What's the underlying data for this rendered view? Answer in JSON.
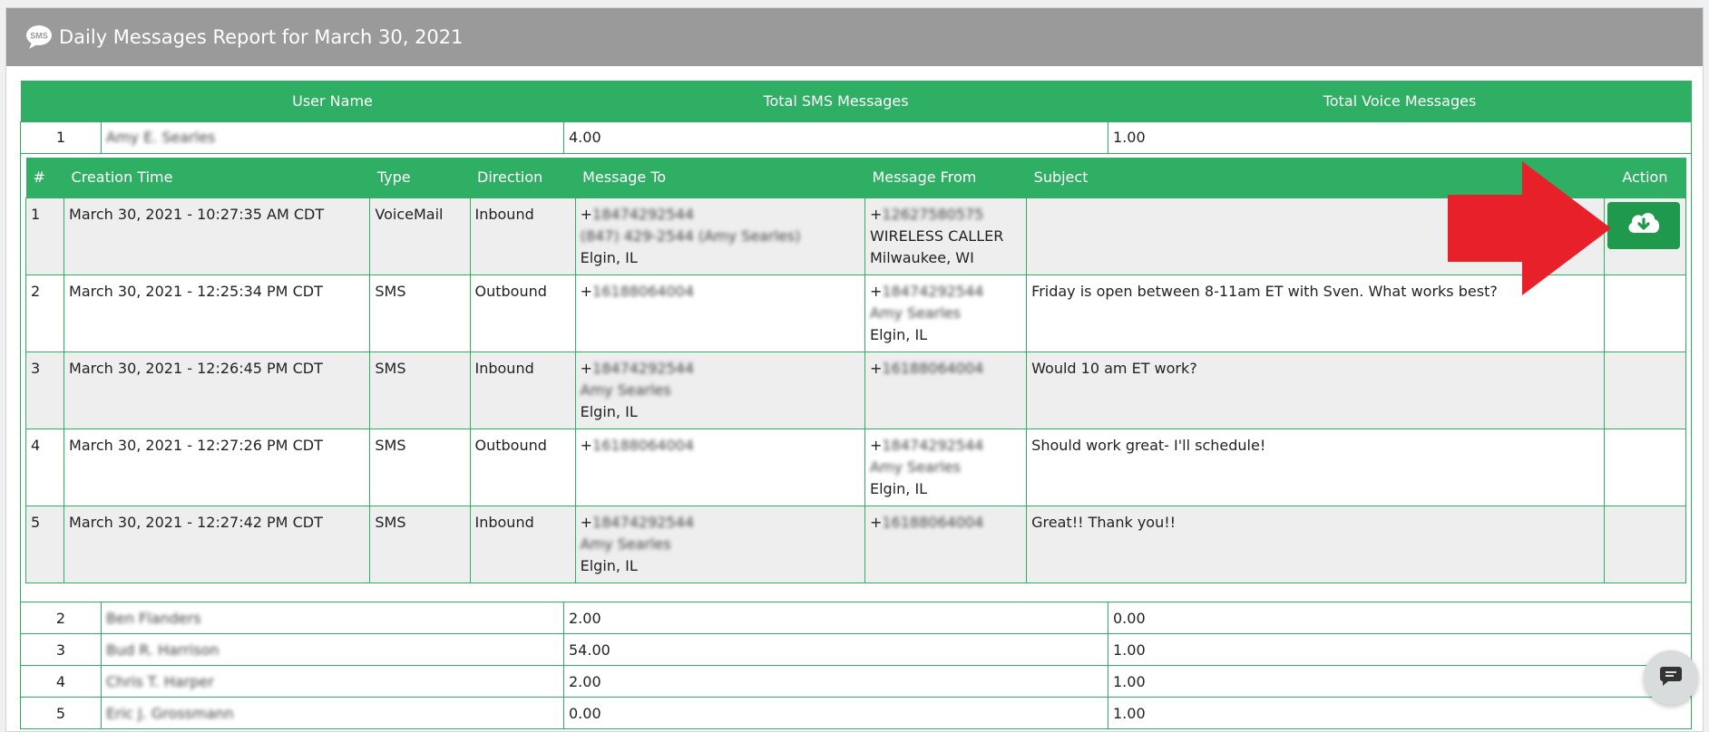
{
  "header": {
    "icon": "sms-bubble-icon",
    "title": "Daily Messages Report for March 30, 2021"
  },
  "summary": {
    "columns": [
      "User Name",
      "Total SMS Messages",
      "Total Voice Messages"
    ],
    "rows": [
      {
        "idx": "1",
        "name": "Amy E. Searles",
        "sms": "4.00",
        "voice": "1.00"
      },
      {
        "idx": "2",
        "name": "Ben Flanders",
        "sms": "2.00",
        "voice": "0.00"
      },
      {
        "idx": "3",
        "name": "Bud R. Harrison",
        "sms": "54.00",
        "voice": "1.00"
      },
      {
        "idx": "4",
        "name": "Chris T. Harper",
        "sms": "2.00",
        "voice": "1.00"
      },
      {
        "idx": "5",
        "name": "Eric J. Grossmann",
        "sms": "0.00",
        "voice": "1.00"
      }
    ]
  },
  "detail": {
    "columns": [
      "#",
      "Creation Time",
      "Type",
      "Direction",
      "Message To",
      "Message From",
      "Subject",
      "Action"
    ],
    "rows": [
      {
        "num": "1",
        "time": "March 30, 2021 - 10:27:35 AM CDT",
        "type": "VoiceMail",
        "direction": "Inbound",
        "to": {
          "plus": "+",
          "number": "18474292544",
          "name": "(847) 429-2544 (Amy Searles)",
          "city": "Elgin, IL"
        },
        "from": {
          "plus": "+",
          "number": "12627580575",
          "name": "WIRELESS CALLER",
          "city": "Milwaukee, WI"
        },
        "subject": "",
        "action_icon": "cloud-download-icon"
      },
      {
        "num": "2",
        "time": "March 30, 2021 - 12:25:34 PM CDT",
        "type": "SMS",
        "direction": "Outbound",
        "to": {
          "plus": "+",
          "number": "16188064004",
          "name": "",
          "city": ""
        },
        "from": {
          "plus": "+",
          "number": "18474292544",
          "name": "Amy Searles",
          "city": "Elgin, IL"
        },
        "subject": "Friday is open between 8-11am ET with Sven. What works best?"
      },
      {
        "num": "3",
        "time": "March 30, 2021 - 12:26:45 PM CDT",
        "type": "SMS",
        "direction": "Inbound",
        "to": {
          "plus": "+",
          "number": "18474292544",
          "name": "Amy Searles",
          "city": "Elgin, IL"
        },
        "from": {
          "plus": "+",
          "number": "16188064004",
          "name": "",
          "city": ""
        },
        "subject": "Would 10 am ET work?"
      },
      {
        "num": "4",
        "time": "March 30, 2021 - 12:27:26 PM CDT",
        "type": "SMS",
        "direction": "Outbound",
        "to": {
          "plus": "+",
          "number": "16188064004",
          "name": "",
          "city": ""
        },
        "from": {
          "plus": "+",
          "number": "18474292544",
          "name": "Amy Searles",
          "city": "Elgin, IL"
        },
        "subject": "Should work great- I'll schedule!"
      },
      {
        "num": "5",
        "time": "March 30, 2021 - 12:27:42 PM CDT",
        "type": "SMS",
        "direction": "Inbound",
        "to": {
          "plus": "+",
          "number": "18474292544",
          "name": "Amy Searles",
          "city": "Elgin, IL"
        },
        "from": {
          "plus": "+",
          "number": "16188064004",
          "name": "",
          "city": ""
        },
        "subject": "Great!! Thank you!!"
      }
    ]
  },
  "annotation": {
    "icon": "red-arrow-icon",
    "color": "#e8202a"
  },
  "chat": {
    "icon": "chat-bubble-icon"
  },
  "colors": {
    "accent": "#2eaf63",
    "header": "#9a9a9a",
    "button": "#1f9a4d"
  }
}
